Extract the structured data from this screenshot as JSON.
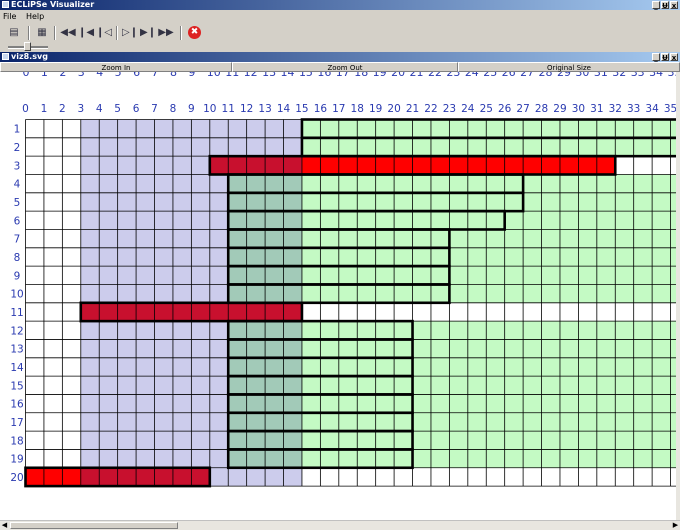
{
  "app": {
    "title": "ECLiPSe Visualizer",
    "window_buttons": [
      "_",
      "Ʉ",
      "x"
    ],
    "menu": [
      "File",
      "Help"
    ]
  },
  "toolbar": {
    "buttons": [
      {
        "name": "open-folder-icon",
        "glyph": "▤"
      },
      {
        "name": "grid-view-icon",
        "glyph": "▦"
      },
      {
        "name": "rewind-icon",
        "glyph": "◀◀"
      },
      {
        "name": "step-back-icon",
        "glyph": "❙◀"
      },
      {
        "name": "skip-start-icon",
        "glyph": "❙◁"
      },
      {
        "name": "skip-end-icon",
        "glyph": "▷❙"
      },
      {
        "name": "step-forward-icon",
        "glyph": "▶❙"
      },
      {
        "name": "fast-forward-icon",
        "glyph": "▶▶"
      }
    ],
    "stop_glyph": "✖"
  },
  "document": {
    "title": "viz8.svg",
    "window_buttons": [
      "_",
      "Ʉ",
      "x"
    ]
  },
  "zoom": {
    "zoom_in": "Zoom In",
    "zoom_out": "Zoom Out",
    "original": "Original Size"
  },
  "grid": {
    "columns": 36,
    "rows": 20,
    "colors": {
      "background": "#ffffff",
      "lavender": "#ccccec",
      "green": "#c4fac4",
      "teal": "#a2cab8",
      "dark_red": "#c8102e",
      "red": "#ff0000",
      "line": "#000000",
      "label": "#2a3ab0"
    },
    "lavender_cols": [
      3,
      15
    ],
    "green_start_col": 15,
    "teal_cols": [
      11,
      15
    ],
    "teal_rows": [
      4,
      10,
      12,
      19
    ],
    "red_bars": [
      {
        "row": 3,
        "start": 10,
        "end": 32,
        "dark_end": 15
      },
      {
        "row": 11,
        "start": 3,
        "end": 15,
        "dark_end": 15
      },
      {
        "row": 20,
        "start": 0,
        "end": 10,
        "dark_end": 3,
        "dark_first": false
      }
    ],
    "task_bars": [
      {
        "row": 1,
        "start": 15,
        "end": 36
      },
      {
        "row": 2,
        "start": 15,
        "end": 36
      },
      {
        "row": 4,
        "start": 11,
        "end": 27
      },
      {
        "row": 5,
        "start": 11,
        "end": 27
      },
      {
        "row": 6,
        "start": 11,
        "end": 26
      },
      {
        "row": 7,
        "start": 11,
        "end": 23
      },
      {
        "row": 8,
        "start": 11,
        "end": 23
      },
      {
        "row": 9,
        "start": 11,
        "end": 23
      },
      {
        "row": 10,
        "start": 11,
        "end": 23
      },
      {
        "row": 12,
        "start": 11,
        "end": 21
      },
      {
        "row": 13,
        "start": 11,
        "end": 21
      },
      {
        "row": 14,
        "start": 11,
        "end": 21
      },
      {
        "row": 15,
        "start": 11,
        "end": 21
      },
      {
        "row": 16,
        "start": 11,
        "end": 21
      },
      {
        "row": 17,
        "start": 11,
        "end": 21
      },
      {
        "row": 18,
        "start": 11,
        "end": 21
      },
      {
        "row": 19,
        "start": 11,
        "end": 21
      }
    ],
    "white_green_rows": [
      3,
      11,
      20
    ]
  }
}
